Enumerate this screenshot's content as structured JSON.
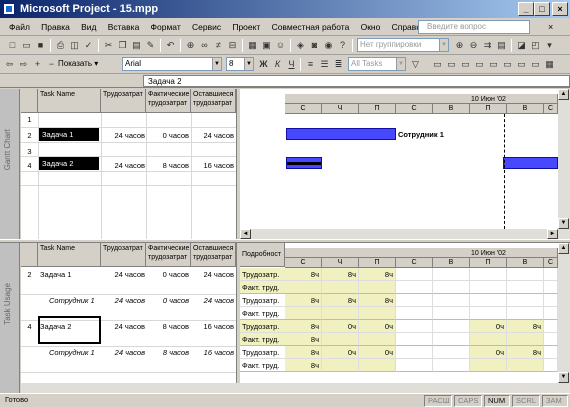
{
  "window": {
    "title": "Microsoft Project - 15.mpp",
    "min": "_",
    "max": "□",
    "close": "×"
  },
  "menu": [
    "Файл",
    "Правка",
    "Вид",
    "Вставка",
    "Формат",
    "Сервис",
    "Проект",
    "Совместная работа",
    "Окно",
    "Справка"
  ],
  "help_placeholder": "Введите вопрос",
  "toolbar1": {
    "group_combo": "Нет группировки"
  },
  "toolbar2": {
    "show_label": "Показать",
    "font": "Arial",
    "size": "8",
    "bold": "Ж",
    "italic": "К",
    "underline": "Ч",
    "filter": "All Tasks"
  },
  "entry_value": "Задача 2",
  "gantt": {
    "vlabel": "Gantt Chart",
    "headers": [
      "",
      "Task Name",
      "Трудозатрат",
      "Фактические трудозатрат",
      "Оставшиеся трудозатрат"
    ],
    "rows": [
      {
        "id": "1",
        "name": "",
        "w1": "",
        "w2": "",
        "w3": ""
      },
      {
        "id": "2",
        "name": "Задача 1",
        "w1": "24 часов",
        "w2": "0 часов",
        "w3": "24 часов"
      },
      {
        "id": "3",
        "name": "",
        "w1": "",
        "w2": "",
        "w3": ""
      },
      {
        "id": "4",
        "name": "Задача 2",
        "w1": "24 часов",
        "w2": "8 часов",
        "w3": "16 часов"
      }
    ],
    "timescale_top": "10 Июн '02",
    "days": [
      "С",
      "Ч",
      "П",
      "С",
      "В",
      "П",
      "В",
      "С"
    ],
    "bar_label": "Сотрудник 1"
  },
  "usage": {
    "vlabel": "Task Usage",
    "headers": [
      "",
      "Task Name",
      "Трудозатрат",
      "Фактические трудозатрат",
      "Оставшиеся трудозатрат"
    ],
    "details_header": "Подробност",
    "timescale_top": "10 Июн '02",
    "days": [
      "С",
      "Ч",
      "П",
      "С",
      "В",
      "П",
      "В",
      "С"
    ],
    "rows": [
      {
        "id": "2",
        "name": "Задача 1",
        "w1": "24 часов",
        "w2": "0 часов",
        "w3": "24 часов",
        "d1": "Трудозатр.",
        "d2": "Факт. труд.",
        "v": [
          "8ч",
          "8ч",
          "8ч",
          "",
          "",
          "",
          "",
          ""
        ],
        "f": [
          "",
          "",
          "",
          "",
          "",
          "",
          "",
          ""
        ]
      },
      {
        "id": "",
        "name": "Сотрудник 1",
        "w1": "24 часов",
        "w2": "0 часов",
        "w3": "24 часов",
        "d1": "Трудозатр.",
        "d2": "Факт. труд.",
        "v": [
          "8ч",
          "8ч",
          "8ч",
          "",
          "",
          "",
          "",
          ""
        ],
        "f": [
          "",
          "",
          "",
          "",
          "",
          "",
          "",
          ""
        ]
      },
      {
        "id": "4",
        "name": "Задача 2",
        "w1": "24 часов",
        "w2": "8 часов",
        "w3": "16 часов",
        "d1": "Трудозатр.",
        "d2": "Факт. труд.",
        "v": [
          "8ч",
          "0ч",
          "0ч",
          "",
          "",
          "0ч",
          "8ч",
          ""
        ],
        "f": [
          "8ч",
          "",
          "",
          "",
          "",
          "",
          "",
          ""
        ]
      },
      {
        "id": "",
        "name": "Сотрудник 1",
        "w1": "24 часов",
        "w2": "8 часов",
        "w3": "16 часов",
        "d1": "Трудозатр.",
        "d2": "Факт. труд.",
        "v": [
          "8ч",
          "0ч",
          "0ч",
          "",
          "",
          "0ч",
          "8ч",
          ""
        ],
        "f": [
          "8ч",
          "",
          "",
          "",
          "",
          "",
          "",
          ""
        ]
      }
    ]
  },
  "status": {
    "ready": "Готово",
    "k1": "РАСШ",
    "k2": "CAPS",
    "k3": "NUM",
    "k4": "SCRL",
    "k5": "ЗАМ"
  }
}
